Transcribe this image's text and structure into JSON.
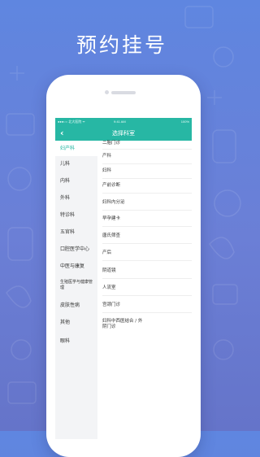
{
  "headline": "预约挂号",
  "status_bar": {
    "carrier": "●●●○○ 北大医院  ᯤ",
    "time": "9:41 AM",
    "battery": "100%"
  },
  "navbar": {
    "back_icon": "chevron-left-icon",
    "title": "选择科室"
  },
  "departments": [
    {
      "label": "妇产科",
      "active": true
    },
    {
      "label": "儿科",
      "active": false
    },
    {
      "label": "内科",
      "active": false
    },
    {
      "label": "外科",
      "active": false
    },
    {
      "label": "特诊科",
      "active": false
    },
    {
      "label": "五官科",
      "active": false
    },
    {
      "label": "口腔医学中心",
      "active": false
    },
    {
      "label": "中医与康复",
      "active": false
    },
    {
      "label": "生殖医学与健康管理",
      "active": false
    },
    {
      "label": "皮肤性病",
      "active": false
    },
    {
      "label": "其他",
      "active": false
    },
    {
      "label": "眼科",
      "active": false
    }
  ],
  "sub_departments": [
    "二胎门诊",
    "产科",
    "妇科",
    "产前诊断",
    "妇科内分泌",
    "早孕建卡",
    "唐氏筛查",
    "产后",
    "阴道镜",
    "人流室",
    "宫颈门诊",
    "妇科中西医结合 / 外阴门诊"
  ],
  "colors": {
    "accent": "#27b7a4",
    "background": "#6b7fd6"
  }
}
